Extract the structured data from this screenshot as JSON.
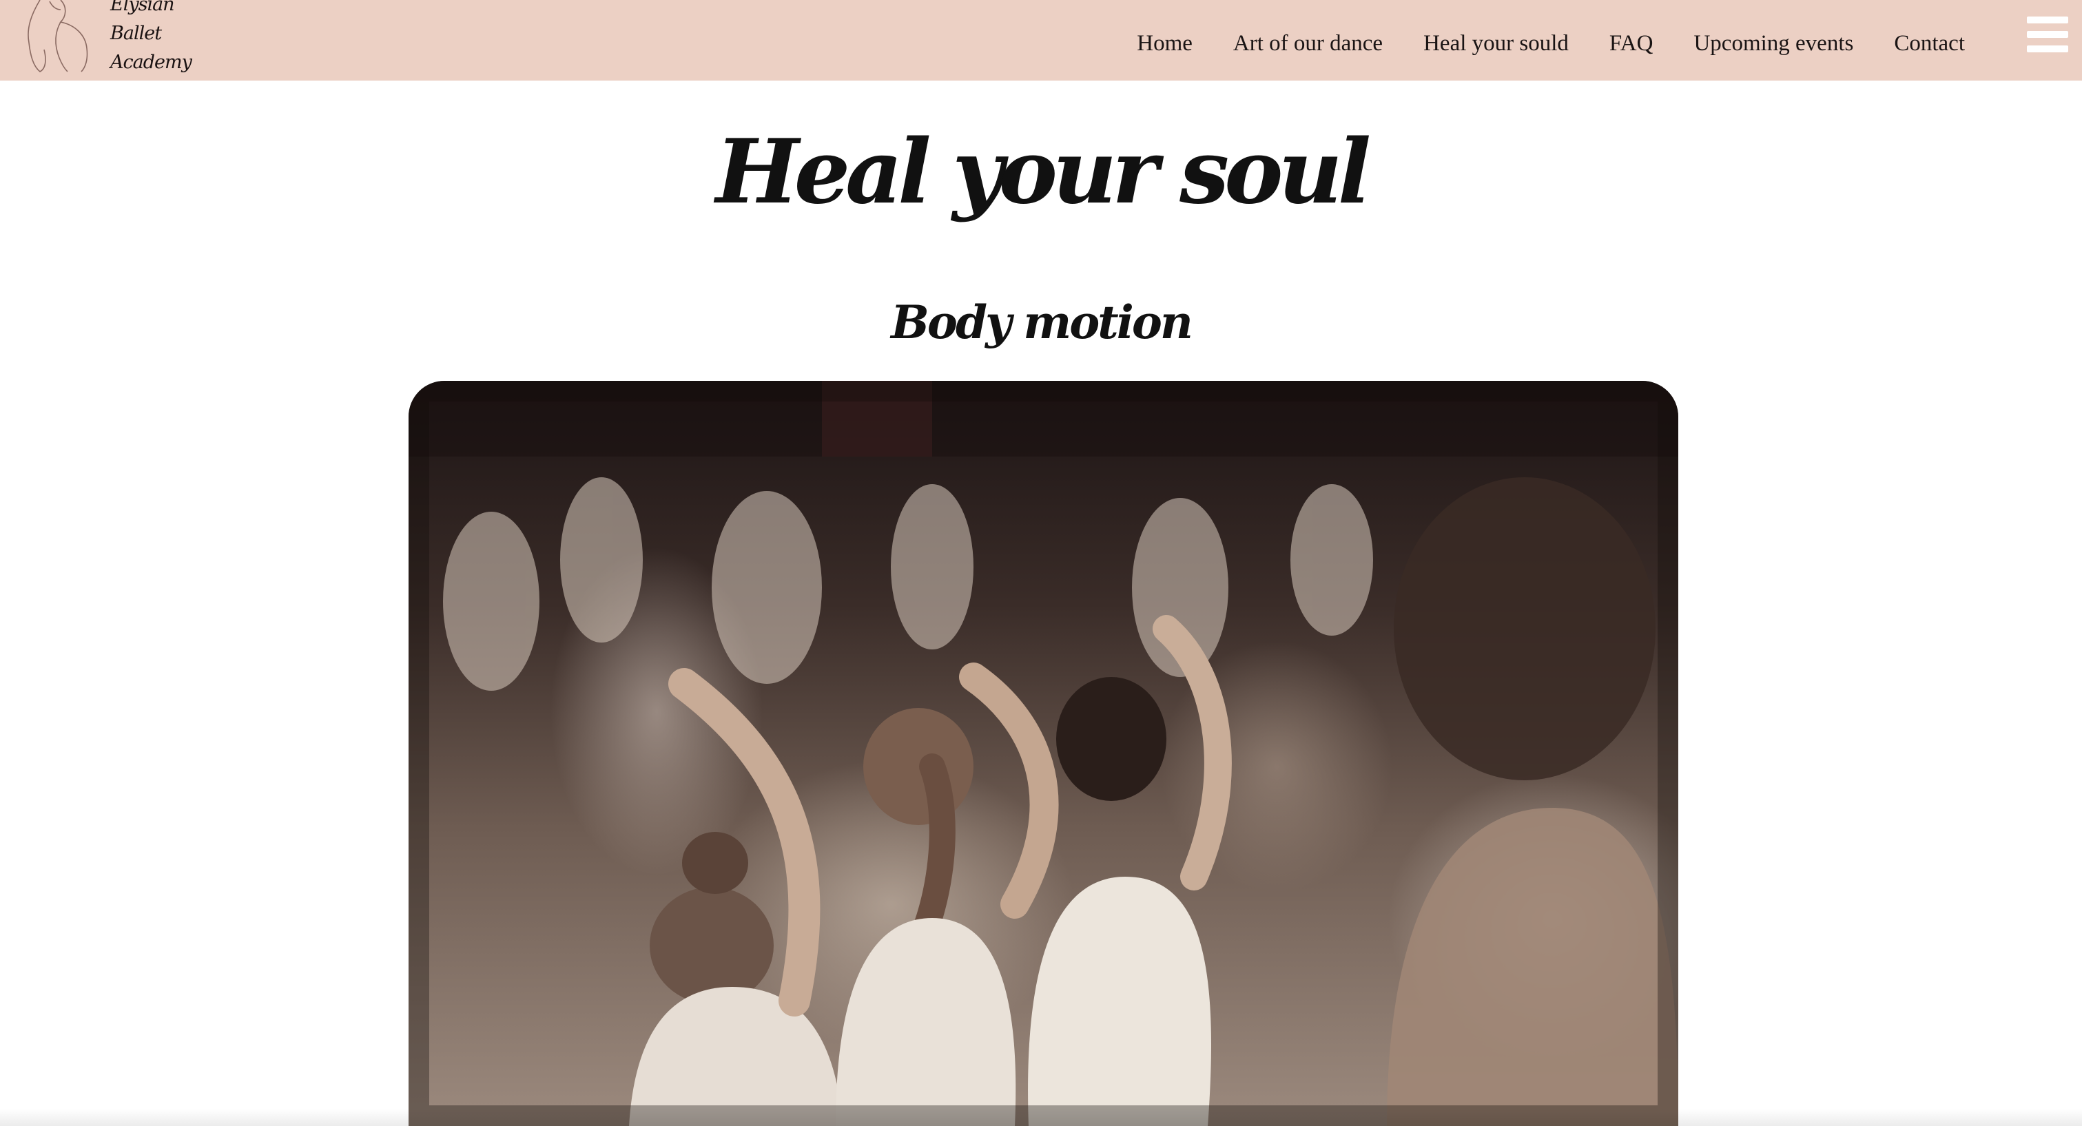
{
  "logo": {
    "icon": "ballerina-outline-icon",
    "lines": [
      "Elysian",
      "Ballet",
      "Academy"
    ]
  },
  "nav": {
    "items": [
      "Home",
      "Art of our dance",
      "Heal your sould",
      "FAQ",
      "Upcoming events",
      "Contact"
    ]
  },
  "menu": {
    "icon": "hamburger-menu-icon"
  },
  "main": {
    "title": "Heal your soul",
    "section_title": "Body motion",
    "photo": {
      "subject": "ballet-dancers-photo"
    }
  },
  "colors": {
    "header_bg": "#ecd0c4",
    "text": "#1a1414",
    "menu_icon": "#ffffff"
  }
}
